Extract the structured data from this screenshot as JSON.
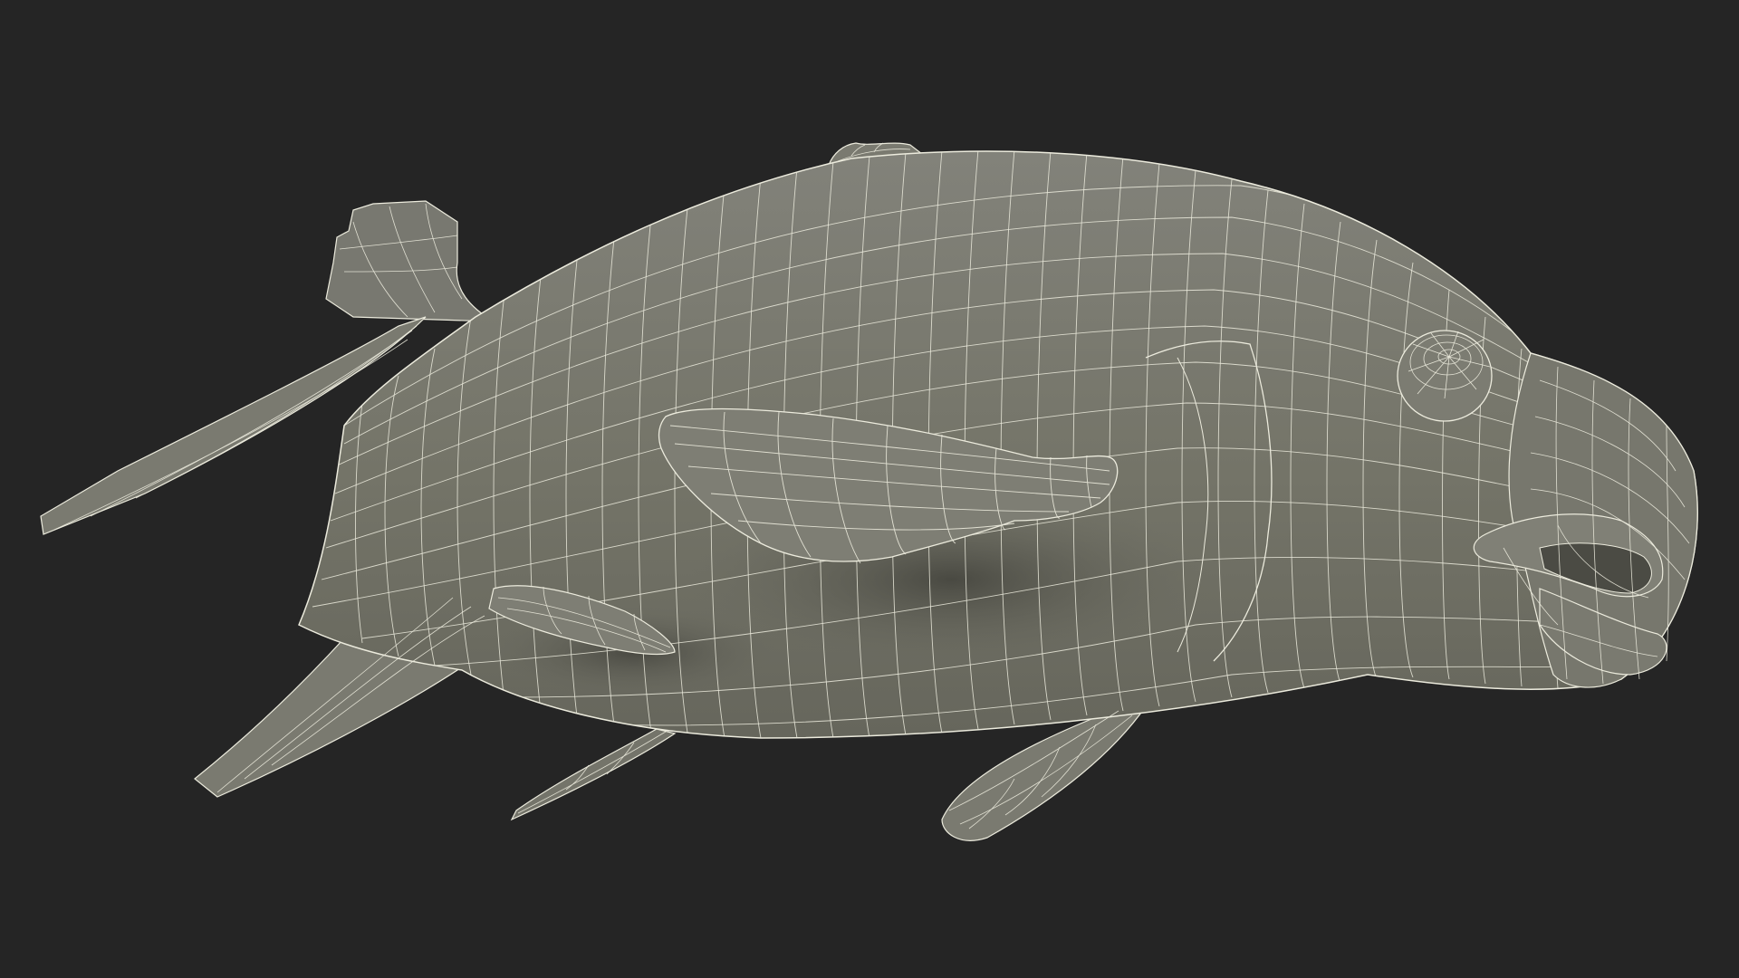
{
  "scene": {
    "subject": "fish-wireframe-model",
    "colors": {
      "background": "#252525",
      "surface": "#747468",
      "surface_dark": "#606056",
      "surface_light": "#85857a",
      "wire": "#ecebdd",
      "shadow": "#3a3a34"
    }
  }
}
